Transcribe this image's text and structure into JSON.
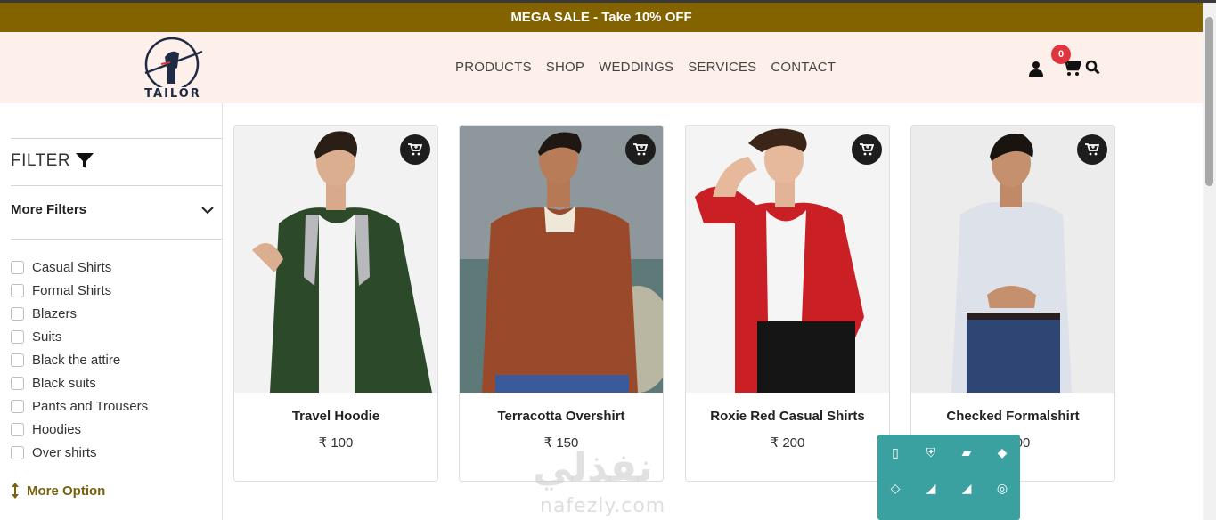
{
  "promo": {
    "text": "MEGA SALE - Take 10% OFF"
  },
  "brand": {
    "name": "TAILOR"
  },
  "nav": [
    {
      "label": "PRODUCTS"
    },
    {
      "label": "SHOP"
    },
    {
      "label": "WEDDINGS"
    },
    {
      "label": "SERVICES"
    },
    {
      "label": "CONTACT"
    }
  ],
  "header_icons": {
    "user": "user-icon",
    "cart": "cart-icon",
    "search": "search-icon",
    "cart_count": "0"
  },
  "sidebar": {
    "filter_label": "FILTER",
    "more_filters_label": "More Filters",
    "categories": [
      {
        "label": "Casual Shirts",
        "checked": false
      },
      {
        "label": "Formal Shirts",
        "checked": false
      },
      {
        "label": "Blazers",
        "checked": false
      },
      {
        "label": "Suits",
        "checked": false
      },
      {
        "label": "Black the attire",
        "checked": false
      },
      {
        "label": "Black suits",
        "checked": false
      },
      {
        "label": "Pants and Trousers",
        "checked": false
      },
      {
        "label": "Hoodies",
        "checked": false
      },
      {
        "label": "Over shirts",
        "checked": false
      }
    ],
    "more_option_label": "More Option"
  },
  "products": [
    {
      "name": "Travel Hoodie",
      "price": "₹ 100",
      "image": "man in green hoodie"
    },
    {
      "name": "Terracotta Overshirt",
      "price": "₹ 150",
      "image": "man in brown overshirt"
    },
    {
      "name": "Roxie Red Casual Shirts",
      "price": "₹ 200",
      "image": "man in red shirt"
    },
    {
      "name": "Checked Formalshirt",
      "price": "₹ 200",
      "image": "man in white shirt"
    }
  ],
  "watermark": {
    "arabic": "نفذلي",
    "latin": "nafezly.com"
  },
  "colors": {
    "promo_bg": "#836300",
    "header_bg": "#fdf0ea",
    "badge": "#e0343f",
    "accent_text": "#7a6110",
    "popup_bg": "#3aa0a0"
  }
}
